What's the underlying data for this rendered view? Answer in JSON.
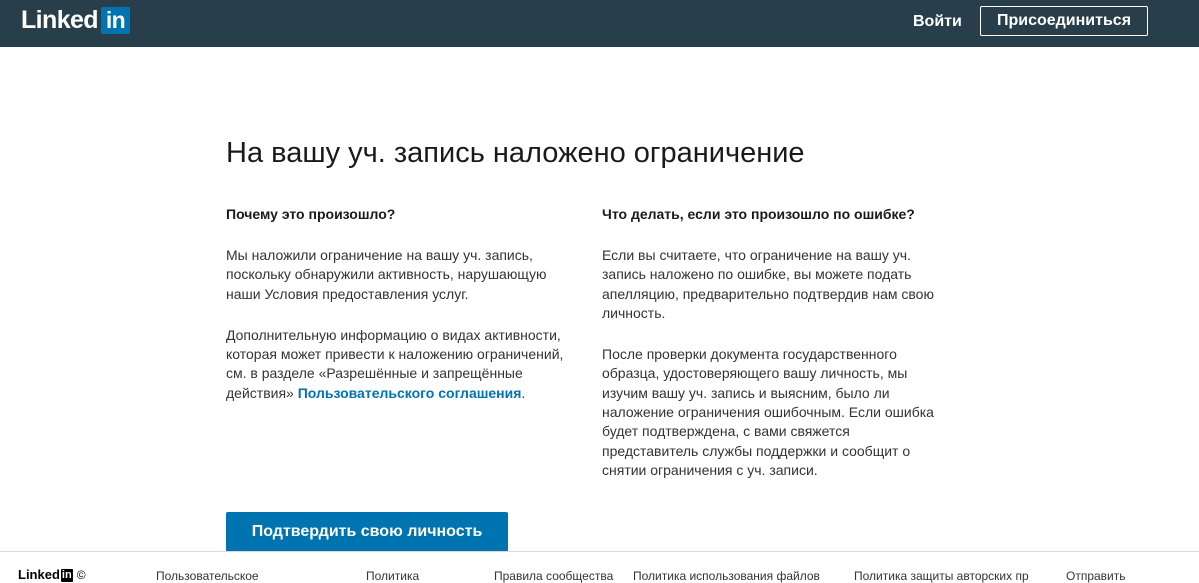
{
  "header": {
    "logo_text": "Linked",
    "logo_box_text": "in",
    "signin_label": "Войти",
    "join_label": "Присоединиться"
  },
  "main": {
    "title": "На вашу уч. запись наложено ограничение",
    "why": {
      "heading": "Почему это произошло?",
      "paragraph1": "Мы наложили ограничение на вашу уч. запись, поскольку обнаружили активность, нарушающую наши Условия предоставления услуг.",
      "paragraph2_text": "Дополнительную информацию о видах активности, которая может привести к наложению ограничений, см. в разделе «Разрешённые и запрещённые действия» ",
      "paragraph2_link": "Пользовательского соглашения",
      "paragraph2_end": "."
    },
    "mistake": {
      "heading": "Что делать, если это произошло по ошибке?",
      "paragraph1": "Если вы считаете, что ограничение на вашу уч. запись наложено по ошибке, вы можете подать апелляцию, предварительно подтвердив нам свою личность.",
      "paragraph2": "После проверки документа государственного образца, удостоверяющего вашу личность, мы изучим вашу уч. запись и выясним, было ли наложение ограничения ошибочным. Если ошибка будет подтверждена, с вами свяжется представитель службы поддержки и сообщит о снятии ограничения с уч. записи."
    },
    "verify_button": "Подтвердить свою личность"
  },
  "footer": {
    "logo_text": "Linked",
    "logo_box_text": "in",
    "copyright": "©",
    "links": [
      "Пользовательское",
      "Политика",
      "Правила сообщества",
      "Политика использования файлов",
      "Политика защиты авторских пр",
      "Отправить"
    ]
  },
  "colors": {
    "header_bg": "#283e4a",
    "brand_blue": "#0073b1"
  }
}
